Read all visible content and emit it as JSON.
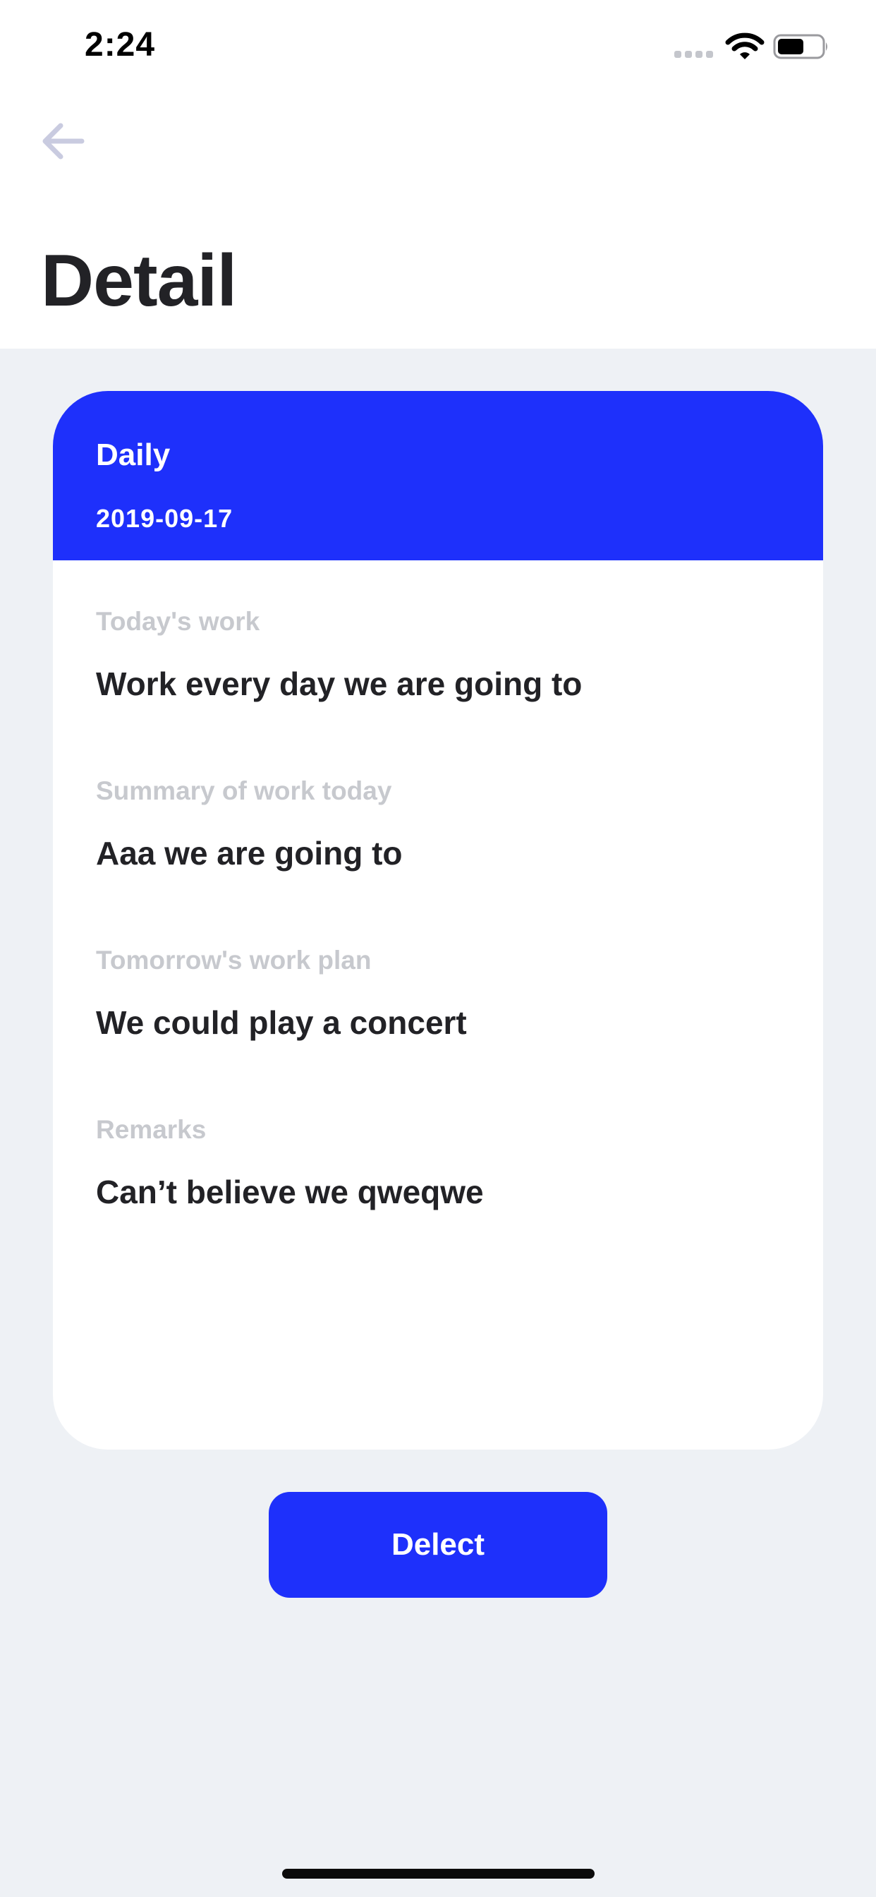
{
  "status_bar": {
    "time": "2:24",
    "icons": [
      "signal-icon",
      "wifi-icon",
      "battery-icon"
    ]
  },
  "header": {
    "back_icon": "arrow-left-icon",
    "title": "Detail"
  },
  "card": {
    "title": "Daily",
    "date": "2019-09-17",
    "fields": [
      {
        "label": "Today's work",
        "value": "Work every day we are going to"
      },
      {
        "label": "Summary of work today",
        "value": "Aaa we are going to"
      },
      {
        "label": "Tomorrow's work plan",
        "value": "We could play a concert"
      },
      {
        "label": "Remarks",
        "value": "Can’t believe we qweqwe"
      }
    ]
  },
  "actions": {
    "delete_label": "Delect"
  },
  "colors": {
    "accent": "#1e30fb",
    "background": "#eef1f5",
    "label_gray": "#c7c9ce",
    "text_dark": "#222226"
  }
}
